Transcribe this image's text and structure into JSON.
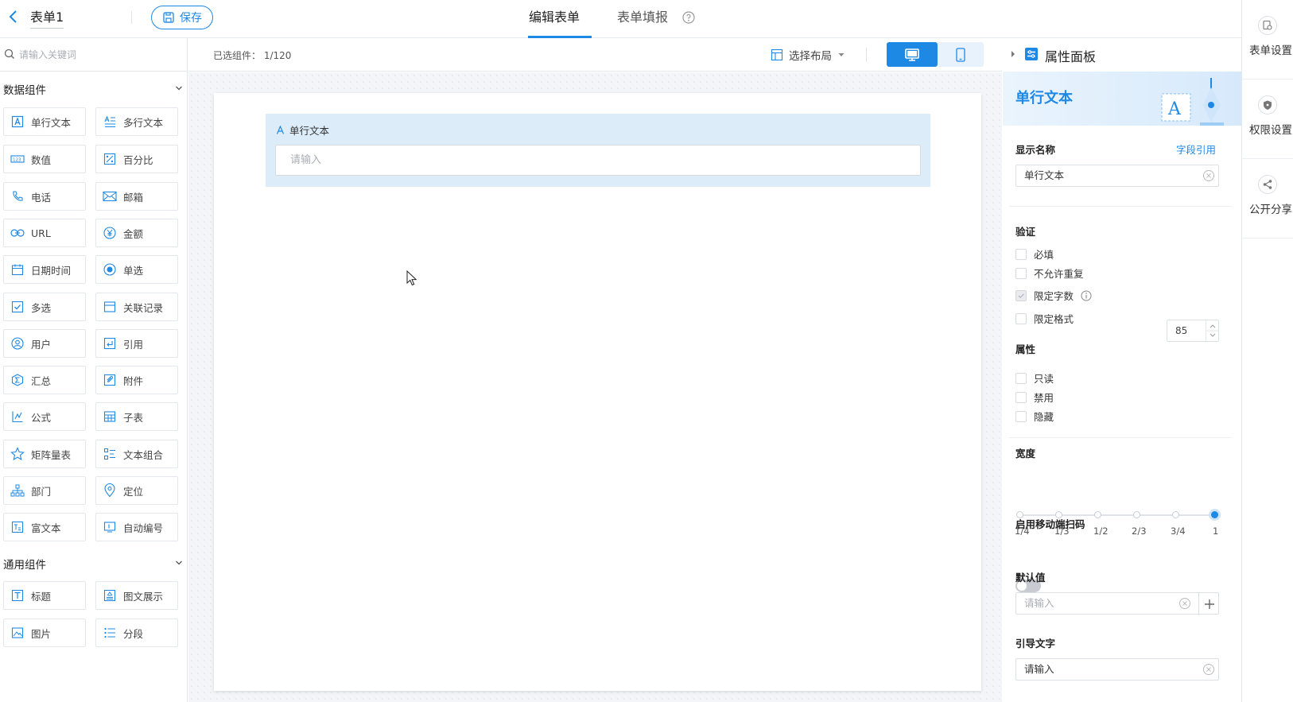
{
  "topbar": {
    "form_title": "表单1",
    "save_label": "保存",
    "tabs": [
      {
        "label": "编辑表单",
        "active": true
      },
      {
        "label": "表单填报",
        "active": false
      }
    ]
  },
  "right_rail": {
    "items": [
      {
        "label": "表单设置",
        "icon": "form-settings-icon"
      },
      {
        "label": "权限设置",
        "icon": "shield-icon"
      },
      {
        "label": "公开分享",
        "icon": "share-icon"
      }
    ]
  },
  "left_panel": {
    "search_placeholder": "请输入关键词",
    "groups": [
      {
        "title": "数据组件",
        "items": [
          {
            "label": "单行文本",
            "icon": "single-line-text-icon"
          },
          {
            "label": "多行文本",
            "icon": "multi-line-text-icon"
          },
          {
            "label": "数值",
            "icon": "number-icon"
          },
          {
            "label": "百分比",
            "icon": "percent-icon"
          },
          {
            "label": "电话",
            "icon": "phone-icon"
          },
          {
            "label": "邮箱",
            "icon": "mail-icon"
          },
          {
            "label": "URL",
            "icon": "link-icon"
          },
          {
            "label": "金额",
            "icon": "currency-icon"
          },
          {
            "label": "日期时间",
            "icon": "calendar-icon"
          },
          {
            "label": "单选",
            "icon": "radio-icon"
          },
          {
            "label": "多选",
            "icon": "checkbox-icon"
          },
          {
            "label": "关联记录",
            "icon": "related-record-icon"
          },
          {
            "label": "用户",
            "icon": "user-icon"
          },
          {
            "label": "引用",
            "icon": "reference-icon"
          },
          {
            "label": "汇总",
            "icon": "summary-icon"
          },
          {
            "label": "附件",
            "icon": "attachment-icon"
          },
          {
            "label": "公式",
            "icon": "formula-icon"
          },
          {
            "label": "子表",
            "icon": "subtable-icon"
          },
          {
            "label": "矩阵量表",
            "icon": "star-icon"
          },
          {
            "label": "文本组合",
            "icon": "text-combo-icon"
          },
          {
            "label": "部门",
            "icon": "department-icon"
          },
          {
            "label": "定位",
            "icon": "location-pin-icon"
          },
          {
            "label": "富文本",
            "icon": "rich-text-icon"
          },
          {
            "label": "自动编号",
            "icon": "auto-number-icon"
          }
        ]
      },
      {
        "title": "通用组件",
        "items": [
          {
            "label": "标题",
            "icon": "heading-icon"
          },
          {
            "label": "图文展示",
            "icon": "image-text-icon"
          },
          {
            "label": "图片",
            "icon": "image-icon"
          },
          {
            "label": "分段",
            "icon": "section-list-icon"
          }
        ]
      }
    ]
  },
  "canvas": {
    "selected_count": "已选组件：  1/120",
    "layout_label": "选择布局",
    "field": {
      "label": "单行文本",
      "placeholder": "请输入"
    }
  },
  "properties": {
    "panel_title": "属性面板",
    "component_name": "单行文本",
    "display_name_label": "显示名称",
    "field_ref_link": "字段引用",
    "display_name_value": "单行文本",
    "validation_label": "验证",
    "validation": [
      {
        "label": "必填",
        "checked": false
      },
      {
        "label": "不允许重复",
        "checked": false
      },
      {
        "label": "限定字数",
        "checked": true
      },
      {
        "label": "限定格式",
        "checked": false
      }
    ],
    "char_limit_value": "85",
    "attributes_label": "属性",
    "attributes": [
      {
        "label": "只读",
        "checked": false
      },
      {
        "label": "禁用",
        "checked": false
      },
      {
        "label": "隐藏",
        "checked": false
      }
    ],
    "width_label": "宽度",
    "width_stops": [
      "1/4",
      "1/3",
      "1/2",
      "2/3",
      "3/4",
      "1"
    ],
    "width_selected": "1",
    "mobile_scan_label": "启用移动端扫码",
    "mobile_scan_enabled": false,
    "default_value_label": "默认值",
    "default_value_placeholder": "请输入",
    "guide_text_label": "引导文字",
    "guide_text_value": "请输入"
  },
  "colors": {
    "accent": "#1e88e5",
    "field_highlight": "#dcecf9"
  }
}
